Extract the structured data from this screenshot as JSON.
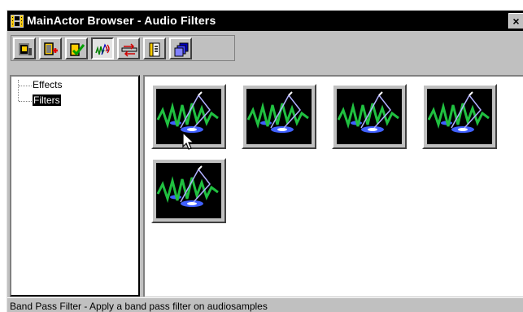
{
  "window": {
    "title": "MainActor Browser -  Audio Filters",
    "close_label": "×"
  },
  "toolbar": {
    "buttons": [
      {
        "icon": "film-clip-icon",
        "pressed": false
      },
      {
        "icon": "add-clip-icon",
        "pressed": false
      },
      {
        "icon": "check-clip-icon",
        "pressed": false
      },
      {
        "icon": "audio-wave-icon",
        "pressed": true
      },
      {
        "icon": "transition-arrows-icon",
        "pressed": false
      },
      {
        "icon": "text-document-icon",
        "pressed": false
      },
      {
        "icon": "stacked-windows-icon",
        "pressed": false
      }
    ]
  },
  "tree": {
    "items": [
      {
        "label": "Effects",
        "selected": false
      },
      {
        "label": "Filters",
        "selected": true
      }
    ]
  },
  "filters": {
    "items": [
      {
        "name": "band-pass-filter",
        "selected": true
      },
      {
        "name": "filter-2",
        "selected": false
      },
      {
        "name": "filter-3",
        "selected": false
      },
      {
        "name": "filter-4",
        "selected": false
      },
      {
        "name": "filter-5",
        "selected": false
      }
    ]
  },
  "status": {
    "text": "Band Pass Filter - Apply a band pass filter on audiosamples"
  }
}
